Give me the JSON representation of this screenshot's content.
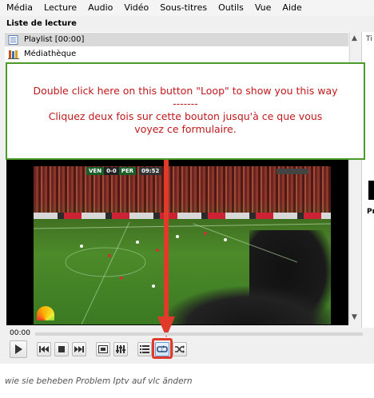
{
  "menu": [
    "Média",
    "Lecture",
    "Audio",
    "Vidéo",
    "Sous-titres",
    "Outils",
    "Vue",
    "Aide"
  ],
  "playlist": {
    "header": "Liste de lecture",
    "items": [
      {
        "label": "Playlist [00:00]",
        "icon": "playlist-icon",
        "selected": true
      },
      {
        "label": "Médiathèque",
        "icon": "media-library-icon",
        "selected": false
      }
    ]
  },
  "side_panel": {
    "top_text": "Ti",
    "bottom_text": "Pr"
  },
  "annotation": {
    "line1": "Double click here on this button \"Loop\" to show you this way",
    "line2": "-------",
    "line3": "Cliquez deux fois sur cette bouton jusqu'à ce que vous",
    "line4": "voyez ce formulaire."
  },
  "video": {
    "team_home": "VEN",
    "score": "0-0",
    "team_away": "PER",
    "clock": "09:52"
  },
  "player": {
    "elapsed": "00:00",
    "buttons": [
      "play-icon",
      "previous-icon",
      "stop-icon",
      "next-icon",
      "fullscreen-icon",
      "extended-settings-icon",
      "playlist-toggle-icon",
      "loop-icon",
      "shuffle-icon"
    ]
  },
  "caption": "wie sie beheben Problem Iptv auf vlc ändern",
  "colors": {
    "annotation_text": "#c0191c",
    "annotation_border": "#4c9a2a",
    "arrow": "#e03a2b",
    "selected_row": "#d9d9d9"
  }
}
